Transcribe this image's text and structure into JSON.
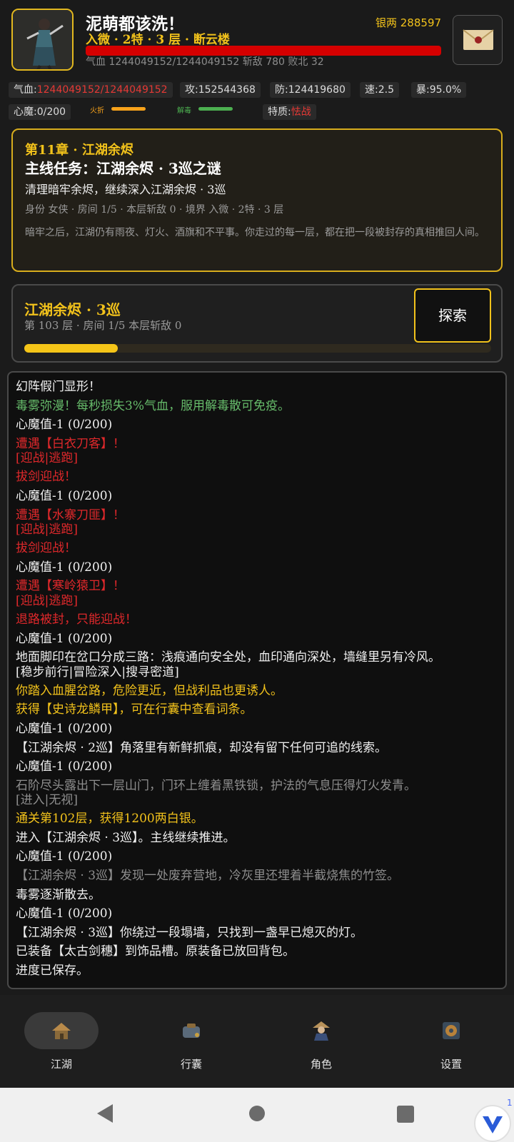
{
  "header": {
    "name": "泥萌都该洗！",
    "realm": "入微 · 2特 · 3 层 · 断云楼",
    "silver": "银两 288597",
    "hp_fraction": 1.0,
    "stats_line": "气血 1244049152/1244049152   斩敌 780   败北 32"
  },
  "stats": {
    "hp_label": "气血:",
    "hp_value": "1244049152/1244049152",
    "atk": "攻:152544368",
    "def": "防:124419680",
    "spd": "速:2.5",
    "crit": "暴:95.0%",
    "heart_demon": "心魔:0/200",
    "fire_label": "火折",
    "fire_fraction": 1.0,
    "fire_color": "#f7a21b",
    "antidote_label": "解毒",
    "antidote_fraction": 1.0,
    "antidote_color": "#4caf50",
    "trait_label": "特质:",
    "trait_value": "怯战"
  },
  "quest": {
    "chapter": "第11章 · 江湖余烬",
    "title": "主线任务：江湖余烬 · 3巡之谜",
    "desc": "清理暗牢余烬，继续深入江湖余烬 · 3巡",
    "meta": "身份 女侠 · 房间 1/5 · 本层斩敌 0 · 境界 入微 · 2特 · 3 层",
    "story": "暗牢之后，江湖仍有雨夜、灯火、酒旗和不平事。你走过的每一层，都在把一段被封存的真相推回人间。"
  },
  "location": {
    "title": "江湖余烬 · 3巡",
    "subtitle": "第 103 层 · 房间 1/5   本层斩敌 0",
    "explore_label": "探索",
    "progress_fraction": 0.2
  },
  "log": [
    {
      "text": "幻阵假门显形！",
      "color": "white"
    },
    {
      "text": "毒雾弥漫！每秒损失3%气血，服用解毒散可免疫。",
      "color": "green"
    },
    {
      "text": "心魔值-1 (0/200)",
      "color": "white"
    },
    {
      "text": "遭遇【白衣刀客】！",
      "color": "red"
    },
    {
      "text": "[迎战|逃跑]",
      "color": "red",
      "opt": true
    },
    {
      "text": "拔剑迎战！",
      "color": "red"
    },
    {
      "text": "心魔值-1 (0/200)",
      "color": "white"
    },
    {
      "text": "遭遇【水寨刀匪】！",
      "color": "red"
    },
    {
      "text": "[迎战|逃跑]",
      "color": "red",
      "opt": true
    },
    {
      "text": "拔剑迎战！",
      "color": "red"
    },
    {
      "text": "心魔值-1 (0/200)",
      "color": "white"
    },
    {
      "text": "遭遇【寒岭猿卫】！",
      "color": "red"
    },
    {
      "text": "[迎战|逃跑]",
      "color": "red",
      "opt": true
    },
    {
      "text": "退路被封，只能迎战！",
      "color": "red"
    },
    {
      "text": "心魔值-1 (0/200)",
      "color": "white"
    },
    {
      "text": "地面脚印在岔口分成三路：浅痕通向安全处，血印通向深处，墙缝里另有冷风。",
      "color": "white"
    },
    {
      "text": "[稳步前行|冒险深入|搜寻密道]",
      "color": "white",
      "opt": true
    },
    {
      "text": "你踏入血腥岔路，危险更近，但战利品也更诱人。",
      "color": "gold"
    },
    {
      "text": "获得【史诗龙鳞甲】，可在行囊中查看词条。",
      "color": "gold"
    },
    {
      "text": "心魔值-1 (0/200)",
      "color": "white"
    },
    {
      "text": "【江湖余烬 · 2巡】角落里有新鲜抓痕，却没有留下任何可追的线索。",
      "color": "white"
    },
    {
      "text": "心魔值-1 (0/200)",
      "color": "white"
    },
    {
      "text": "石阶尽头露出下一层山门，门环上缠着黑铁锁，护法的气息压得灯火发青。",
      "color": "gray"
    },
    {
      "text": "[进入|无视]",
      "color": "gray",
      "opt": true
    },
    {
      "text": "通关第102层，获得1200两白银。",
      "color": "gold"
    },
    {
      "text": "进入【江湖余烬 · 3巡】。主线继续推进。",
      "color": "white"
    },
    {
      "text": "心魔值-1 (0/200)",
      "color": "white"
    },
    {
      "text": "【江湖余烬 · 3巡】发现一处废弃营地，冷灰里还埋着半截烧焦的竹签。",
      "color": "gray"
    },
    {
      "text": "毒雾逐渐散去。",
      "color": "white"
    },
    {
      "text": "心魔值-1 (0/200)",
      "color": "white"
    },
    {
      "text": "【江湖余烬 · 3巡】你绕过一段塌墙，只找到一盏早已熄灭的灯。",
      "color": "white"
    },
    {
      "text": "已装备【太古剑穗】到饰品槽。原装备已放回背包。",
      "color": "white"
    },
    {
      "text": "进度已保存。",
      "color": "white"
    }
  ],
  "nav": [
    {
      "label": "江湖",
      "icon": "hut-icon",
      "active": true
    },
    {
      "label": "行囊",
      "icon": "bag-icon",
      "active": false
    },
    {
      "label": "角色",
      "icon": "character-icon",
      "active": false
    },
    {
      "label": "设置",
      "icon": "settings-book-icon",
      "active": false
    }
  ],
  "system": {
    "vpn_badge": "1"
  }
}
